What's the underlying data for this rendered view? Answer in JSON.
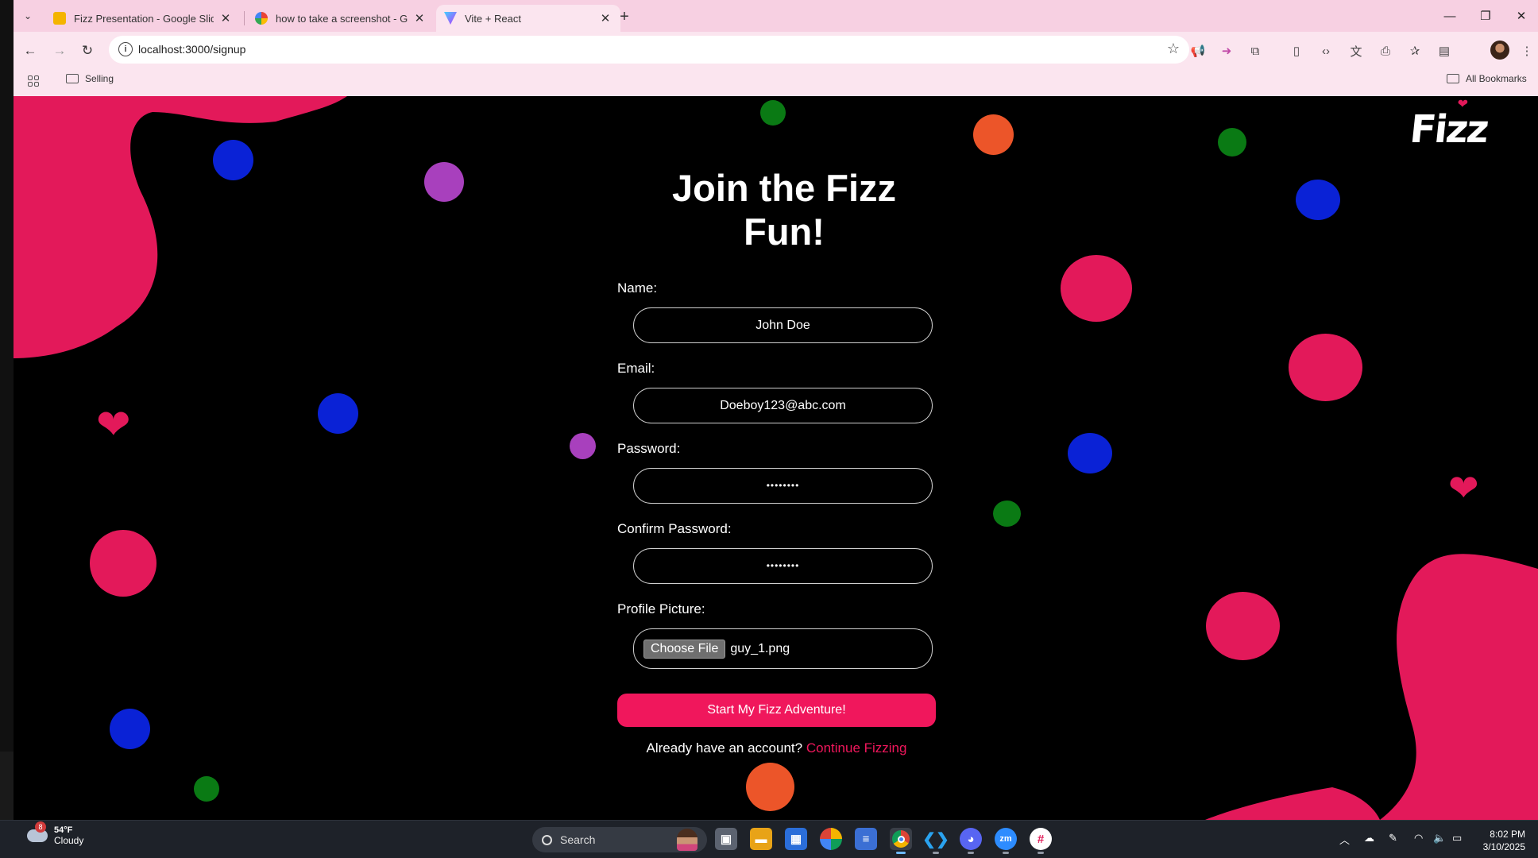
{
  "browser": {
    "tabs": [
      {
        "title": "Fizz Presentation - Google Slides",
        "active": false
      },
      {
        "title": "how to take a screenshot - Google",
        "active": false
      },
      {
        "title": "Vite + React",
        "active": true
      }
    ],
    "url": "localhost:3000/signup",
    "bookmarks": {
      "selling": "Selling",
      "all": "All Bookmarks"
    }
  },
  "page": {
    "logo": "Fizz",
    "title": "Join the Fizz\nFun!",
    "form": {
      "name_label": "Name:",
      "name_value": "John Doe",
      "email_label": "Email:",
      "email_value": "Doeboy123@abc.com",
      "password_label": "Password:",
      "password_value": "••••••••",
      "confirm_label": "Confirm Password:",
      "confirm_value": "••••••••",
      "picture_label": "Profile Picture:",
      "choose_file": "Choose File",
      "file_name": "guy_1.png",
      "submit": "Start My Fizz Adventure!"
    },
    "account_prompt": "Already have an account?",
    "account_link": "Continue Fizzing"
  },
  "colors": {
    "pink": "#e3195a",
    "blue": "#0a22d6",
    "purple": "#a840bd",
    "green": "#0a7a14",
    "orange": "#ec5529",
    "accent": "#f0175c"
  },
  "taskbar": {
    "weather_badge": "8",
    "temperature": "54°F",
    "condition": "Cloudy",
    "search_placeholder": "Search",
    "time": "8:02 PM",
    "date": "3/10/2025"
  }
}
